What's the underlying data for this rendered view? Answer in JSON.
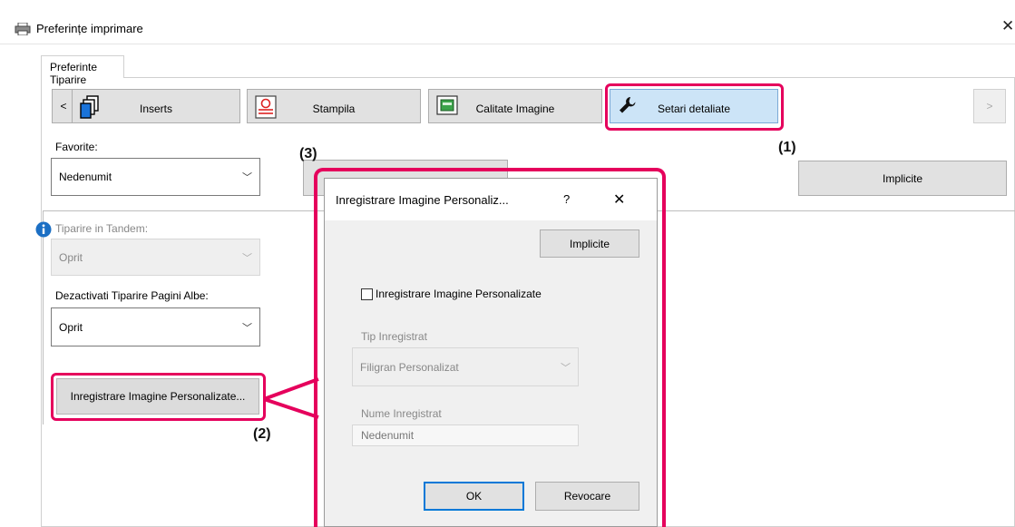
{
  "window": {
    "title": "Preferințe imprimare",
    "close_glyph": "✕"
  },
  "tab": {
    "label": "Preferinte Tiparire"
  },
  "toolbar": {
    "prev_label": "<",
    "next_label": ">",
    "buttons": [
      {
        "label": "Inserts",
        "icon": "inserts-icon"
      },
      {
        "label": "Stampila",
        "icon": "stamp-icon"
      },
      {
        "label": "Calitate Imagine",
        "icon": "image-quality-icon"
      },
      {
        "label": "Setari detaliate",
        "icon": "wrench-icon",
        "active": true
      }
    ]
  },
  "favorites": {
    "label": "Favorite:",
    "value": "Nedenumit"
  },
  "defaults_button": "Implicite",
  "tandem": {
    "label": "Tiparire in Tandem:",
    "value": "Oprit"
  },
  "blank_pages": {
    "label": "Dezactivati Tiparire Pagini Albe:",
    "value": "Oprit"
  },
  "register_button": "Inregistrare Imagine Personalizate...",
  "callouts": {
    "c1": "(1)",
    "c2": "(2)",
    "c3": "(3)"
  },
  "dialog": {
    "title": "Inregistrare Imagine Personaliz...",
    "help": "?",
    "close": "✕",
    "defaults_button": "Implicite",
    "checkbox_label": "Inregistrare Imagine Personalizate",
    "checkbox_checked": false,
    "type_label": "Tip Inregistrat",
    "type_value": "Filigran Personalizat",
    "name_label": "Nume Inregistrat",
    "name_value": "Nedenumit",
    "ok": "OK",
    "cancel": "Revocare"
  },
  "colors": {
    "highlight": "#e5005c",
    "active_bg": "#cce4f7",
    "button_bg": "#e1e1e1"
  }
}
